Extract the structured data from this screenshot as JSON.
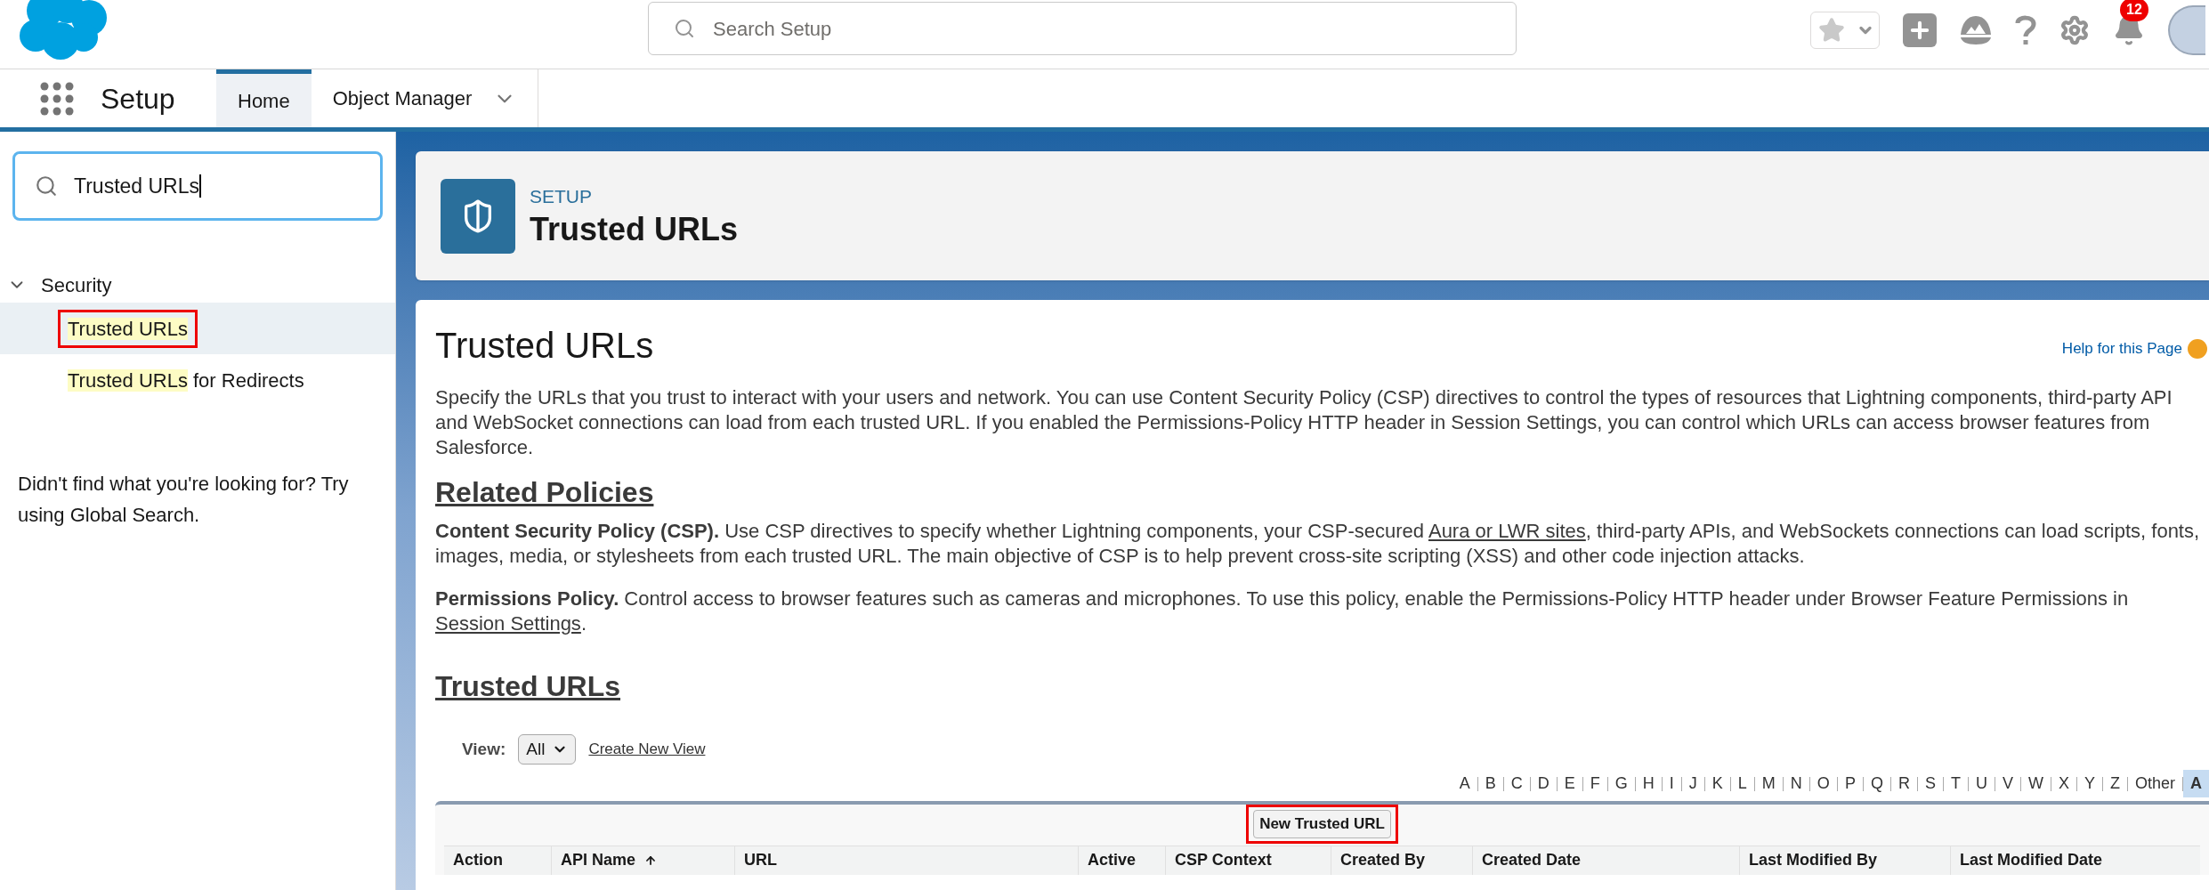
{
  "top_bar": {
    "search_placeholder": "Search Setup",
    "notifications_badge": "12"
  },
  "nav": {
    "app_name": "Setup",
    "tabs": [
      {
        "label": "Home",
        "selected": true,
        "has_menu": false
      },
      {
        "label": "Object Manager",
        "selected": false,
        "has_menu": true
      }
    ]
  },
  "sidebar": {
    "search": {
      "value": "Trusted URLs"
    },
    "groups": [
      {
        "label": "Security",
        "expanded": true,
        "children": [
          {
            "match": "Trusted URLs",
            "selected": true,
            "highlighted": true
          },
          {
            "match": "Trusted URLs",
            "rest": " for Redirects",
            "selected": false,
            "highlighted": false
          }
        ]
      }
    ],
    "hint": "Didn't find what you're looking for? Try using Global Search."
  },
  "page_header": {
    "eyebrow": "SETUP",
    "title": "Trusted URLs"
  },
  "content": {
    "title": "Trusted URLs",
    "help_link": "Help for this Page",
    "intro": "Specify the URLs that you trust to interact with your users and network. You can use Content Security Policy (CSP) directives to control the types of resources that Lightning components, third-party API and WebSocket connections can load from each trusted URL. If you enabled the Permissions-Policy HTTP header in Session Settings, you can control which URLs can access browser features from Salesforce.",
    "sections": [
      {
        "heading": "Related Policies",
        "paragraphs": [
          [
            {
              "kind": "bold",
              "text": "Content Security Policy (CSP)."
            },
            {
              "kind": "text",
              "text": " Use CSP directives to specify whether Lightning components, your CSP-secured "
            },
            {
              "kind": "link",
              "text": "Aura or LWR sites"
            },
            {
              "kind": "text",
              "text": ", third-party APIs, and WebSockets connections can load scripts, fonts, images, media, or stylesheets from each trusted URL. The main objective of CSP is to help prevent cross-site scripting (XSS) and other code injection attacks."
            }
          ],
          [
            {
              "kind": "bold",
              "text": "Permissions Policy."
            },
            {
              "kind": "text",
              "text": " Control access to browser features such as cameras and microphones. To use this policy, enable the Permissions-Policy HTTP header under Browser Feature Permissions in "
            },
            {
              "kind": "link",
              "text": "Session Settings"
            },
            {
              "kind": "text",
              "text": "."
            }
          ]
        ]
      },
      {
        "heading": "Trusted URLs"
      }
    ],
    "view": {
      "label": "View:",
      "value": "All",
      "link": "Create New View"
    },
    "alphabet": [
      {
        "label": "A",
        "selected": false
      },
      {
        "label": "B",
        "selected": false
      },
      {
        "label": "C",
        "selected": false
      },
      {
        "label": "D",
        "selected": false
      },
      {
        "label": "E",
        "selected": false
      },
      {
        "label": "F",
        "selected": false
      },
      {
        "label": "G",
        "selected": false
      },
      {
        "label": "H",
        "selected": false
      },
      {
        "label": "I",
        "selected": false
      },
      {
        "label": "J",
        "selected": false
      },
      {
        "label": "K",
        "selected": false
      },
      {
        "label": "L",
        "selected": false
      },
      {
        "label": "M",
        "selected": false
      },
      {
        "label": "N",
        "selected": false
      },
      {
        "label": "O",
        "selected": false
      },
      {
        "label": "P",
        "selected": false
      },
      {
        "label": "Q",
        "selected": false
      },
      {
        "label": "R",
        "selected": false
      },
      {
        "label": "S",
        "selected": false
      },
      {
        "label": "T",
        "selected": false
      },
      {
        "label": "U",
        "selected": false
      },
      {
        "label": "V",
        "selected": false
      },
      {
        "label": "W",
        "selected": false
      },
      {
        "label": "X",
        "selected": false
      },
      {
        "label": "Y",
        "selected": false
      },
      {
        "label": "Z",
        "selected": false
      },
      {
        "label": "Other",
        "selected": false
      },
      {
        "label": "A",
        "selected": true
      }
    ],
    "new_button": {
      "label": "New Trusted URL",
      "highlighted": true
    },
    "table": {
      "columns": [
        {
          "label": "Action",
          "sorted": false
        },
        {
          "label": "API Name",
          "sorted": true
        },
        {
          "label": "URL",
          "sorted": false
        },
        {
          "label": "Active",
          "sorted": false
        },
        {
          "label": "CSP Context",
          "sorted": false
        },
        {
          "label": "Created By",
          "sorted": false
        },
        {
          "label": "Created Date",
          "sorted": false
        },
        {
          "label": "Last Modified By",
          "sorted": false
        },
        {
          "label": "Last Modified Date",
          "sorted": false
        }
      ]
    }
  }
}
